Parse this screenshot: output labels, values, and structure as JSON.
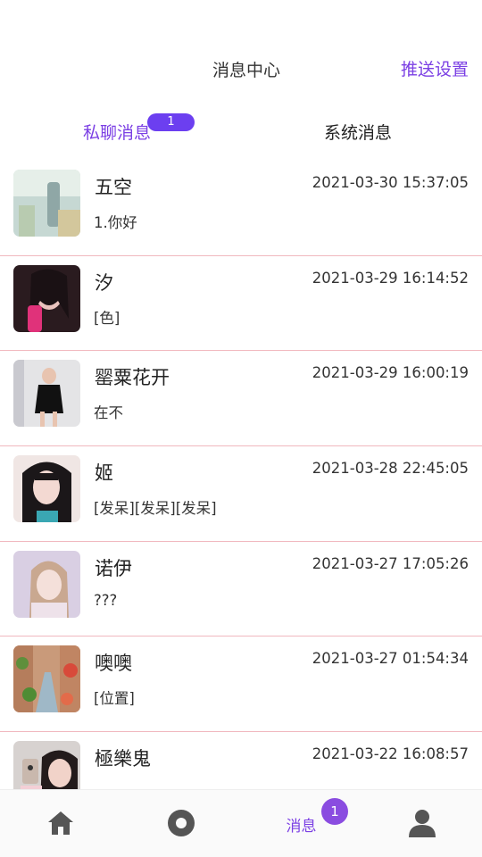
{
  "header": {
    "title": "消息中心",
    "push_settings": "推送设置"
  },
  "tabs": [
    {
      "label": "私聊消息",
      "badge": "1"
    },
    {
      "label": "系统消息"
    }
  ],
  "messages": [
    {
      "name": "五空",
      "time": "2021-03-30 15:37:05",
      "preview": "1.你好"
    },
    {
      "name": "汐",
      "time": "2021-03-29 16:14:52",
      "preview": "[色]"
    },
    {
      "name": "罂粟花开",
      "time": "2021-03-29 16:00:19",
      "preview": "在不"
    },
    {
      "name": "姬",
      "time": "2021-03-28 22:45:05",
      "preview": "[发呆][发呆][发呆]"
    },
    {
      "name": "诺伊",
      "time": "2021-03-27 17:05:26",
      "preview": "???"
    },
    {
      "name": "噢噢",
      "time": "2021-03-27 01:54:34",
      "preview": "[位置]"
    },
    {
      "name": "極樂鬼",
      "time": "2021-03-22 16:08:57",
      "preview": ""
    }
  ],
  "tabbar": {
    "home_icon": "home-icon",
    "discover_icon": "record-icon",
    "messages_label": "消息",
    "messages_badge": "1",
    "profile_icon": "person-icon"
  },
  "colors": {
    "accent": "#7b3fe4",
    "badge": "#6c3ff0",
    "divider": "#f1b8bf"
  }
}
